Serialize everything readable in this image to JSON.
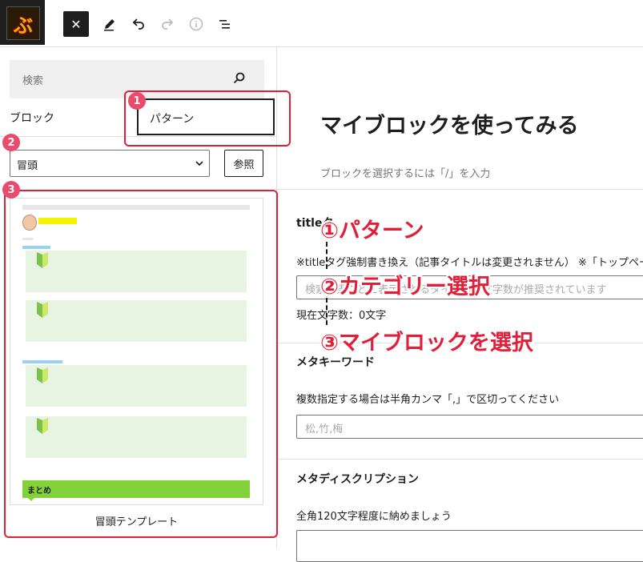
{
  "toolbar": {
    "logo_text": "ぶ",
    "close_label": "✕",
    "tools": [
      "edit-icon",
      "undo-icon",
      "redo-icon",
      "info-icon",
      "list-view-icon"
    ]
  },
  "sidebar": {
    "search_placeholder": "検索",
    "tab_block": "ブロック",
    "tab_pattern": "パターン",
    "category_value": "冒頭",
    "browse_label": "参照",
    "pattern_name": "冒頭テンプレート",
    "preview": {
      "summary_label": "まとめ"
    }
  },
  "editor": {
    "post_title": "マイブロックを使ってみる",
    "block_hint": "ブロックを選択するには「/」を入力"
  },
  "meta": {
    "title_heading": "titleタ",
    "title_note": "※titleタグ強制書き換え（記事タイトルは変更されません） ※「トップペー",
    "title_placeholder": "検索結果などに表示されるタイトル。文字数が推奨されています",
    "char_count": "現在文字数：0文字",
    "keywords_heading": "メタキーワード",
    "keywords_note": "複数指定する場合は半角カンマ「,」で区切ってください",
    "keywords_placeholder": "松,竹,梅",
    "description_heading": "メタディスクリプション",
    "description_note": "全角120文字程度に納めましょう"
  },
  "annotations": {
    "badges": [
      "1",
      "2",
      "3"
    ],
    "callouts": [
      "①パターン",
      "②カテゴリー選択",
      "③マイブロックを選択"
    ],
    "accent": "#e0203a"
  }
}
